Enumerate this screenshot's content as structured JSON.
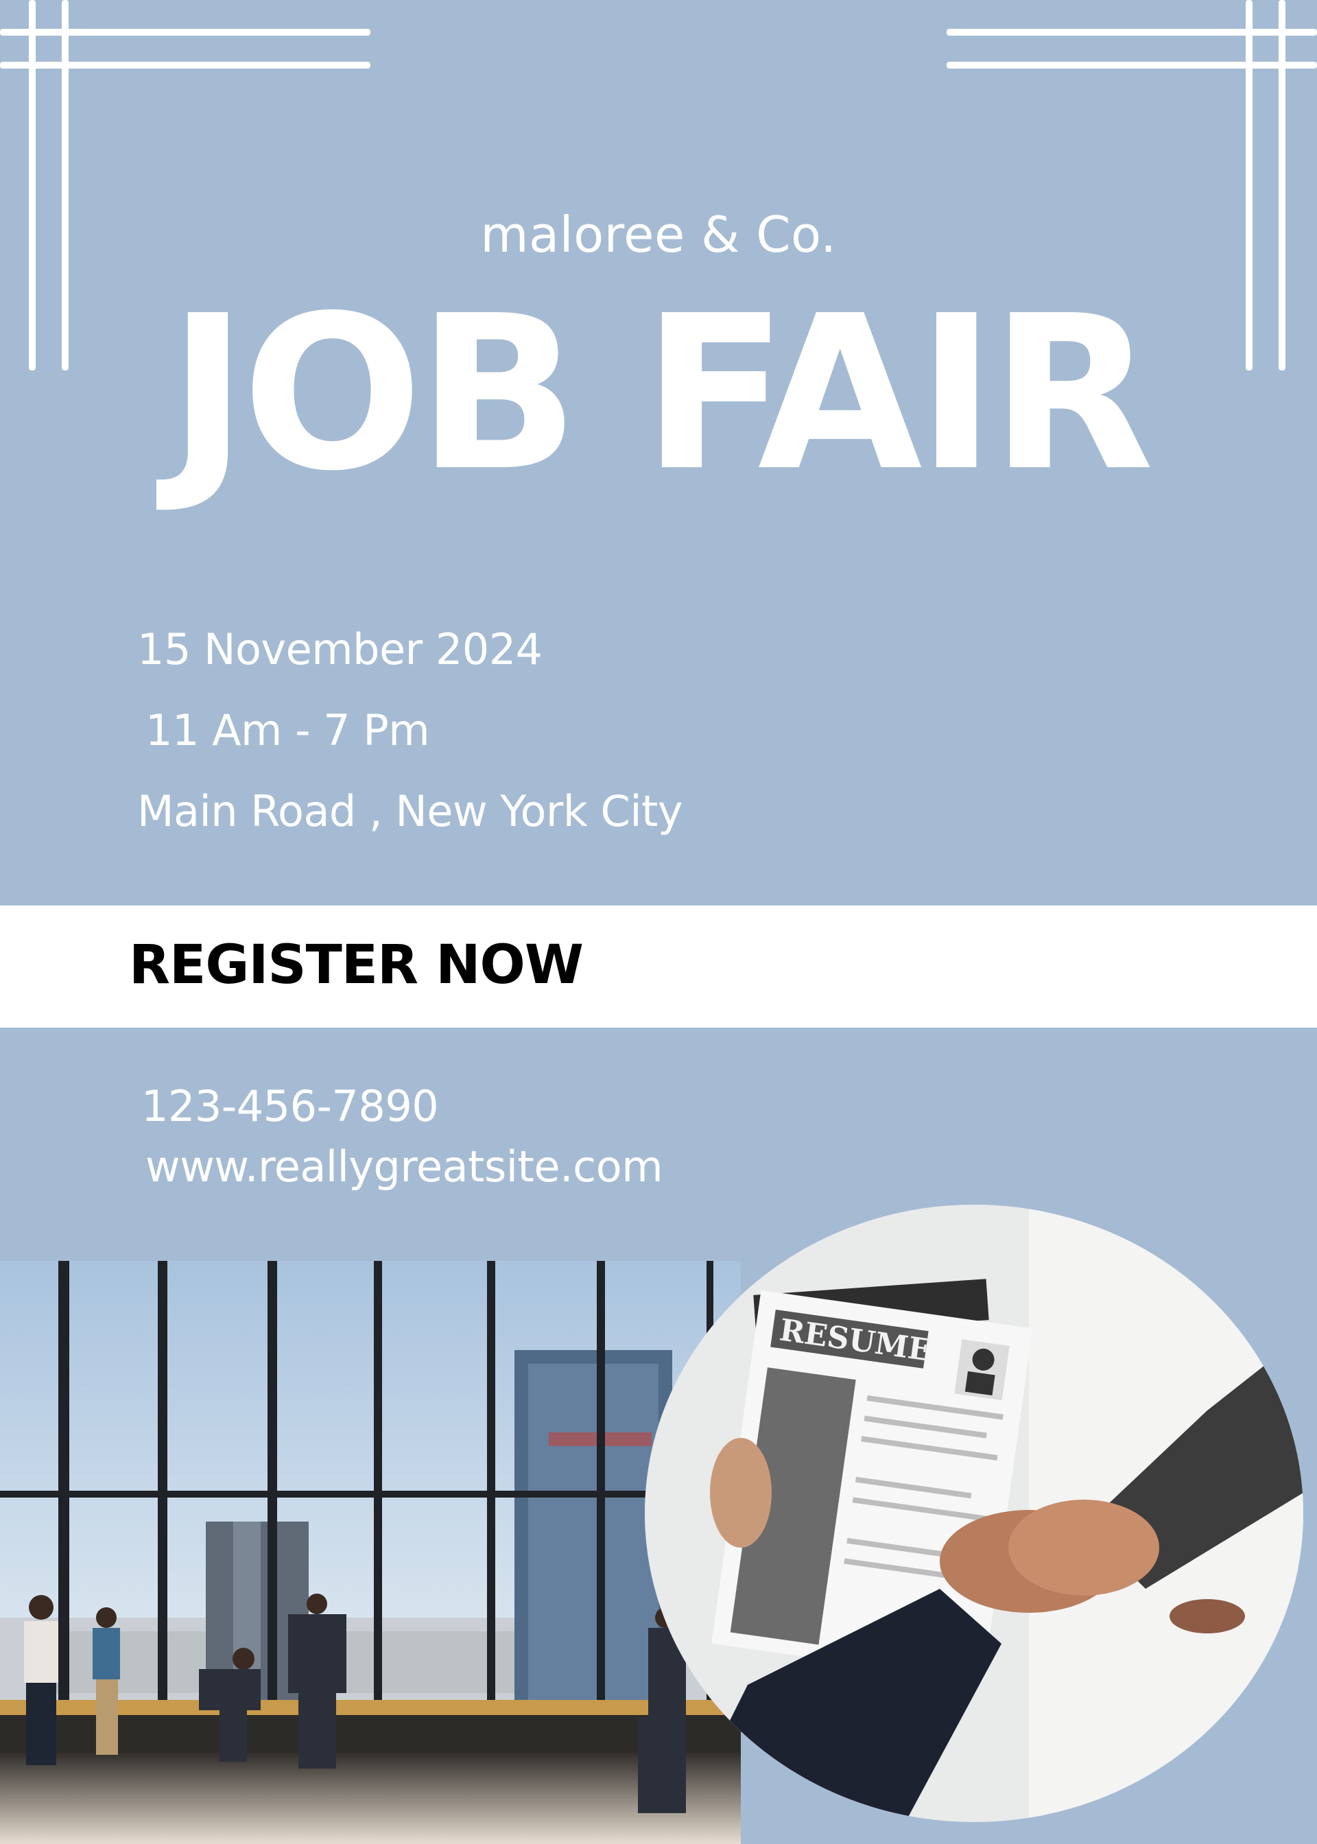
{
  "brand": "maloree & Co.",
  "title": "JOB FAIR",
  "event": {
    "date": "15 November 2024",
    "time": "11 Am - 7 Pm",
    "location": "Main Road , New York City"
  },
  "cta": "REGISTER NOW",
  "contact": {
    "phone": "123-456-7890",
    "website": "www.reallygreatsite.com"
  },
  "photos": {
    "left": "office-hall-people-photo",
    "right": "resume-handshake-photo"
  },
  "resume_word": "RESUME",
  "colors": {
    "background": "#a5bbd3",
    "text": "#ffffff",
    "band": "#ffffff",
    "band_text": "#000000"
  }
}
